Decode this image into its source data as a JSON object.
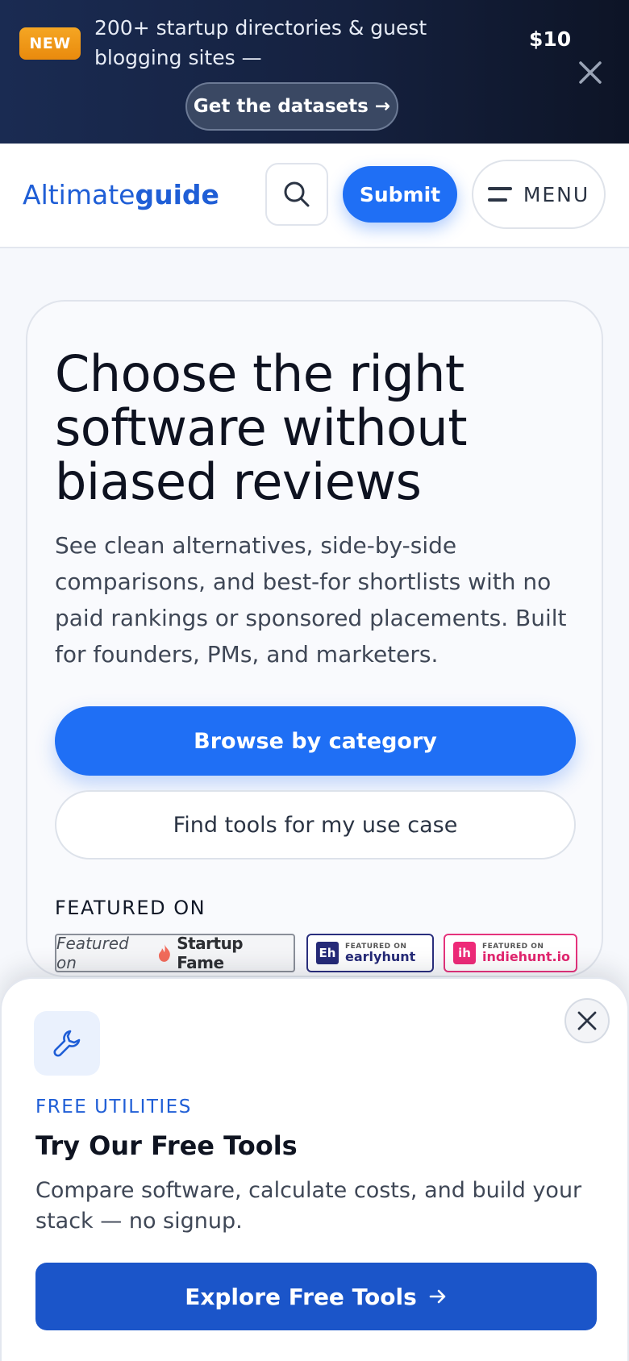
{
  "promo": {
    "badge": "NEW",
    "text": "200+ startup directories & guest blogging sites —",
    "price": "$10",
    "cta": "Get the datasets →"
  },
  "header": {
    "logo_light": "Altimate",
    "logo_bold": "guide",
    "submit": "Submit",
    "menu": "MENU"
  },
  "hero": {
    "title": "Choose the right software without biased reviews",
    "subtitle": "See clean alternatives, side-by-side comparisons, and best-for shortlists with no paid rankings or sponsored placements. Built for founders, PMs, and marketers.",
    "primary_cta": "Browse by category",
    "secondary_cta": "Find tools for my use case",
    "featured_label": "FEATURED ON",
    "badges": {
      "startupfame": {
        "prefix": "Featured on",
        "name": "Startup Fame"
      },
      "earlyhunt": {
        "mark": "Eh",
        "small": "FEATURED ON",
        "name": "earlyhunt"
      },
      "indiehunt": {
        "mark": "ih",
        "small": "FEATURED ON",
        "name": "indiehunt.io"
      }
    }
  },
  "sheet": {
    "kicker": "FREE UTILITIES",
    "title": "Try Our Free Tools",
    "description": "Compare software, calculate costs, and build your stack — no signup.",
    "cta": "Explore Free Tools"
  },
  "colors": {
    "brand": "#1f5ed6",
    "primary_button": "#1f6ff5",
    "sheet_button": "#1b55c9",
    "new_badge": "#f0a01a"
  },
  "icons": [
    "close-icon",
    "search-icon",
    "menu-icon",
    "flame-icon",
    "wrench-icon",
    "arrow-right-icon"
  ]
}
